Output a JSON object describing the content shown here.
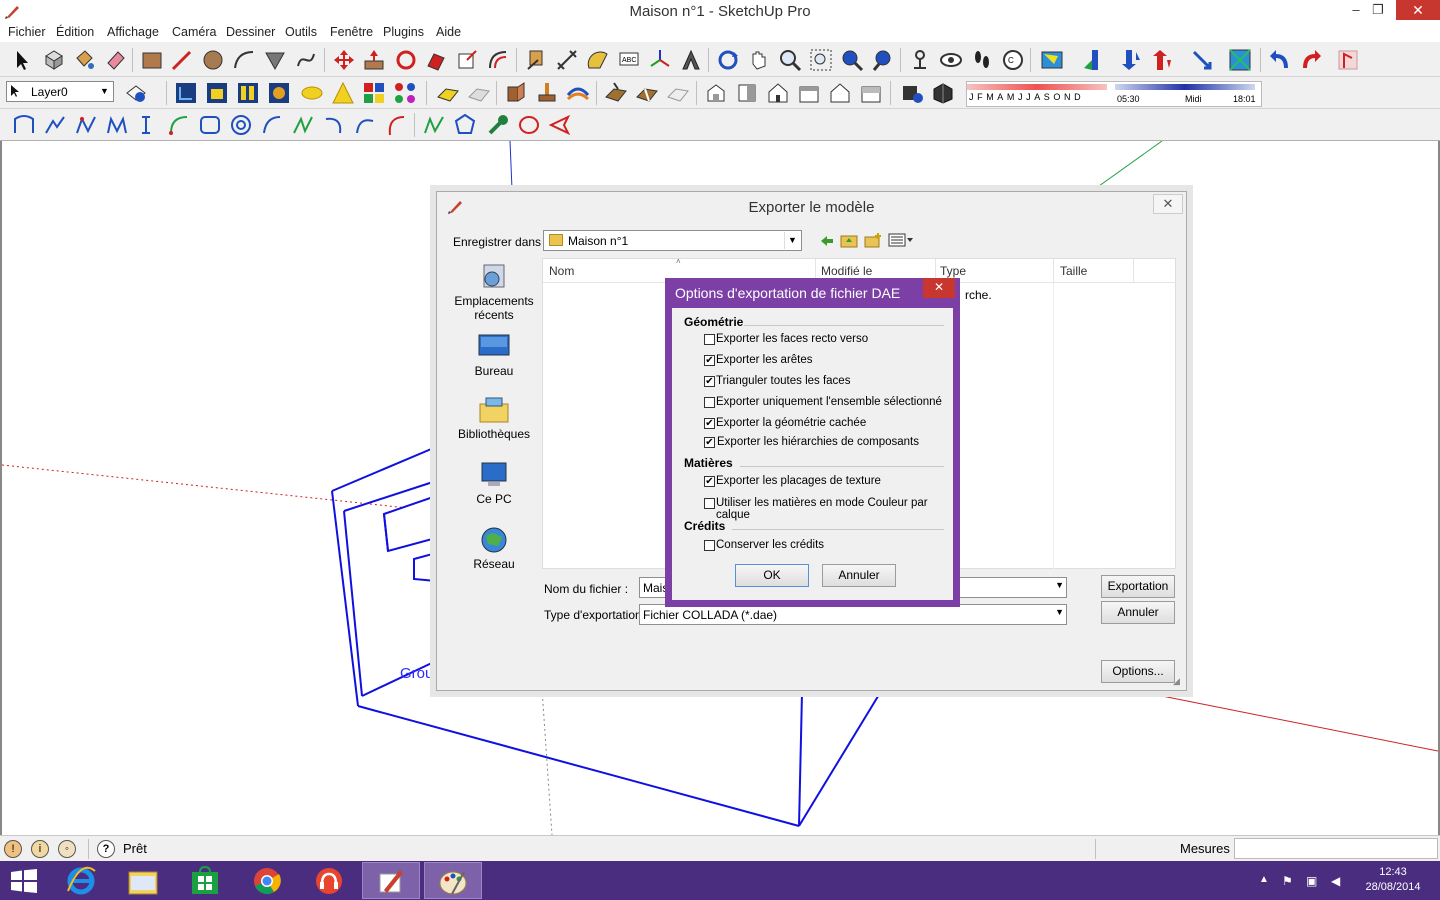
{
  "window": {
    "title": "Maison n°1 - SketchUp Pro",
    "minimize_glyph": "–",
    "restore_glyph": "❐",
    "close_glyph": "✕"
  },
  "menu": [
    "Fichier",
    "Édition",
    "Affichage",
    "Caméra",
    "Dessiner",
    "Outils",
    "Fenêtre",
    "Plugins",
    "Aide"
  ],
  "layer_toolbar": {
    "layer": "Layer0"
  },
  "shadows": {
    "months": "JFMAMJJASOND",
    "time_start": "05:30",
    "time_mid": "Midi",
    "time_end": "18:01"
  },
  "viewport": {
    "group_label": "Group"
  },
  "export_dialog": {
    "title": "Exporter le modèle",
    "save_in_label": "Enregistrer dans :",
    "save_in_value": "Maison n°1",
    "places": [
      {
        "label": "Emplacements récents",
        "icon": "recent-places-icon"
      },
      {
        "label": "Bureau",
        "icon": "desktop-icon"
      },
      {
        "label": "Bibliothèques",
        "icon": "libraries-icon"
      },
      {
        "label": "Ce PC",
        "icon": "this-pc-icon"
      },
      {
        "label": "Réseau",
        "icon": "network-icon"
      }
    ],
    "columns": [
      "Nom",
      "Modifié le",
      "Type",
      "Taille"
    ],
    "empty_text": "rche.",
    "filename_label": "Nom du fichier :",
    "filename_value": "Maiso",
    "type_label": "Type d'exportation",
    "type_value": "Fichier COLLADA (*.dae)",
    "export_button": "Exportation",
    "cancel_button": "Annuler",
    "options_button": "Options..."
  },
  "dae_options": {
    "title": "Options d'exportation de fichier DAE",
    "close_glyph": "✕",
    "sections": [
      {
        "title": "Géométrie",
        "options": [
          {
            "label": "Exporter les faces recto verso",
            "checked": false
          },
          {
            "label": "Exporter les arêtes",
            "checked": true
          },
          {
            "label": "Trianguler toutes les faces",
            "checked": true
          },
          {
            "label": "Exporter uniquement l'ensemble sélectionné",
            "checked": false
          },
          {
            "label": "Exporter la géométrie cachée",
            "checked": true
          },
          {
            "label": "Exporter les hiérarchies de composants",
            "checked": true
          }
        ]
      },
      {
        "title": "Matières",
        "options": [
          {
            "label": "Exporter les placages de texture",
            "checked": true
          },
          {
            "label": "Utiliser les matières en mode Couleur par calque",
            "checked": false
          }
        ]
      },
      {
        "title": "Crédits",
        "options": [
          {
            "label": "Conserver les crédits",
            "checked": false
          }
        ]
      }
    ],
    "ok_button": "OK",
    "cancel_button": "Annuler"
  },
  "statusbar": {
    "status": "Prêt",
    "measures_label": "Mesures",
    "help_glyph": "?"
  },
  "taskbar": {
    "time": "12:43",
    "date": "28/08/2014"
  }
}
